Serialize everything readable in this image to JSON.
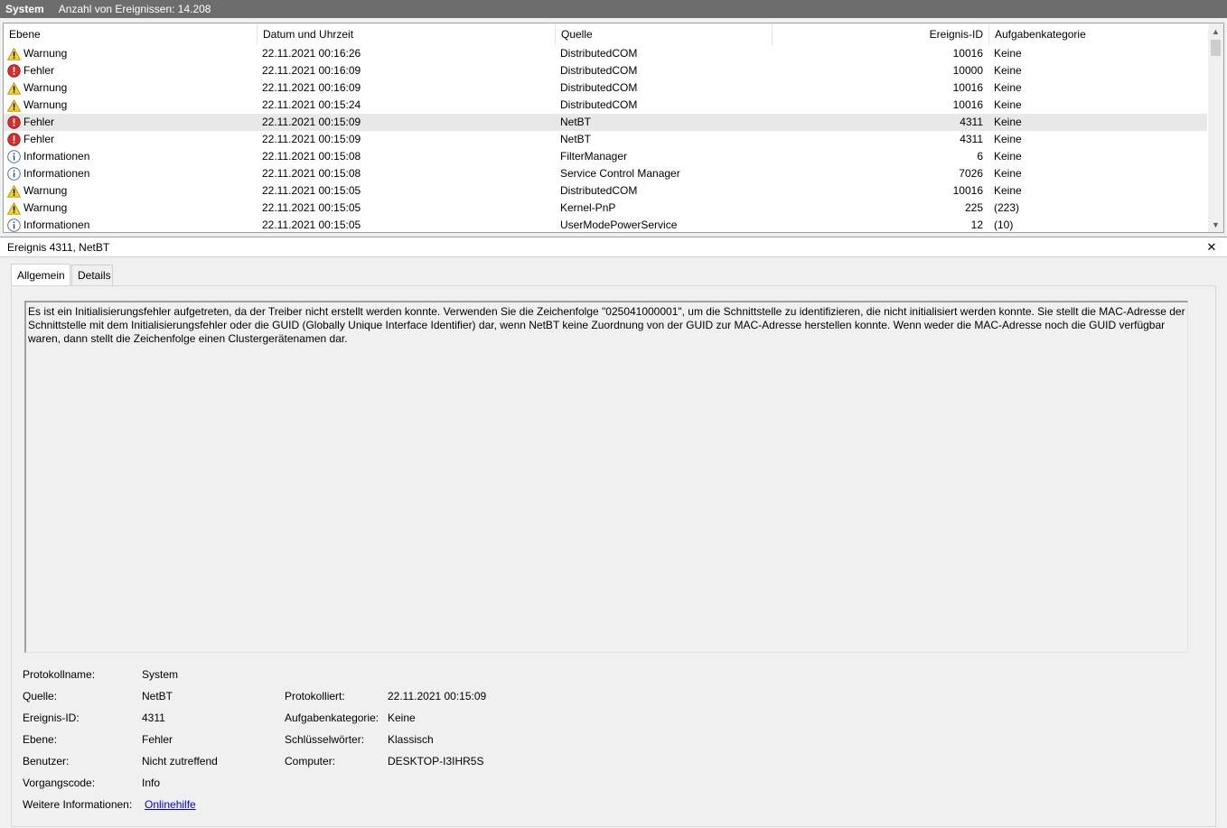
{
  "topbar": {
    "log_name": "System",
    "event_count": "Anzahl von Ereignissen: 14.208"
  },
  "grid": {
    "columns": [
      "Ebene",
      "Datum und Uhrzeit",
      "Quelle",
      "Ereignis-ID",
      "Aufgabenkategorie"
    ],
    "rows": [
      {
        "level": "Warnung",
        "icon": "warning-icon",
        "date": "22.11.2021 00:16:26",
        "source": "DistributedCOM",
        "id": "10016",
        "category": "Keine"
      },
      {
        "level": "Fehler",
        "icon": "error-icon",
        "date": "22.11.2021 00:16:09",
        "source": "DistributedCOM",
        "id": "10000",
        "category": "Keine"
      },
      {
        "level": "Warnung",
        "icon": "warning-icon",
        "date": "22.11.2021 00:16:09",
        "source": "DistributedCOM",
        "id": "10016",
        "category": "Keine"
      },
      {
        "level": "Warnung",
        "icon": "warning-icon",
        "date": "22.11.2021 00:15:24",
        "source": "DistributedCOM",
        "id": "10016",
        "category": "Keine"
      },
      {
        "level": "Fehler",
        "icon": "error-icon",
        "date": "22.11.2021 00:15:09",
        "source": "NetBT",
        "id": "4311",
        "category": "Keine",
        "selected": true
      },
      {
        "level": "Fehler",
        "icon": "error-icon",
        "date": "22.11.2021 00:15:09",
        "source": "NetBT",
        "id": "4311",
        "category": "Keine"
      },
      {
        "level": "Informationen",
        "icon": "info-icon",
        "date": "22.11.2021 00:15:08",
        "source": "FilterManager",
        "id": "6",
        "category": "Keine"
      },
      {
        "level": "Informationen",
        "icon": "info-icon",
        "date": "22.11.2021 00:15:08",
        "source": "Service Control Manager",
        "id": "7026",
        "category": "Keine"
      },
      {
        "level": "Warnung",
        "icon": "warning-icon",
        "date": "22.11.2021 00:15:05",
        "source": "DistributedCOM",
        "id": "10016",
        "category": "Keine"
      },
      {
        "level": "Warnung",
        "icon": "warning-icon",
        "date": "22.11.2021 00:15:05",
        "source": "Kernel-PnP",
        "id": "225",
        "category": "(223)"
      },
      {
        "level": "Informationen",
        "icon": "info-icon",
        "date": "22.11.2021 00:15:05",
        "source": "UserModePowerService",
        "id": "12",
        "category": "(10)"
      }
    ]
  },
  "detail": {
    "title": "Ereignis 4311, NetBT",
    "tabs": [
      "Allgemein",
      "Details"
    ],
    "description": "Es ist ein Initialisierungsfehler aufgetreten, da der Treiber nicht erstellt werden konnte. Verwenden Sie die Zeichenfolge \"025041000001\", um die Schnittstelle zu identifizieren, die nicht initialisiert werden konnte. Sie stellt die MAC-Adresse der Schnittstelle mit dem Initialisierungsfehler oder die  GUID (Globally Unique Interface Identifier) dar, wenn NetBT keine Zuordnung  von der GUID zur MAC-Adresse herstellen konnte. Wenn weder die MAC-Adresse noch die GUID verfügbar waren, dann stellt die Zeichenfolge einen Clustergerätenamen dar.",
    "props": {
      "protokollname_label": "Protokollname:",
      "protokollname": "System",
      "quelle_label": "Quelle:",
      "quelle": "NetBT",
      "protokolliert_label": "Protokolliert:",
      "protokolliert": "22.11.2021 00:15:09",
      "ereignis_id_label": "Ereignis-ID:",
      "ereignis_id": "4311",
      "aufgabenkategorie_label": "Aufgabenkategorie:",
      "aufgabenkategorie": "Keine",
      "ebene_label": "Ebene:",
      "ebene": "Fehler",
      "schluesselwoerter_label": "Schlüsselwörter:",
      "schluesselwoerter": "Klassisch",
      "benutzer_label": "Benutzer:",
      "benutzer": "Nicht zutreffend",
      "computer_label": "Computer:",
      "computer": "DESKTOP-I3IHR5S",
      "vorgangscode_label": "Vorgangscode:",
      "vorgangscode": "Info",
      "weitere_label": "Weitere Informationen:",
      "weitere_link": "Onlinehilfe"
    }
  }
}
